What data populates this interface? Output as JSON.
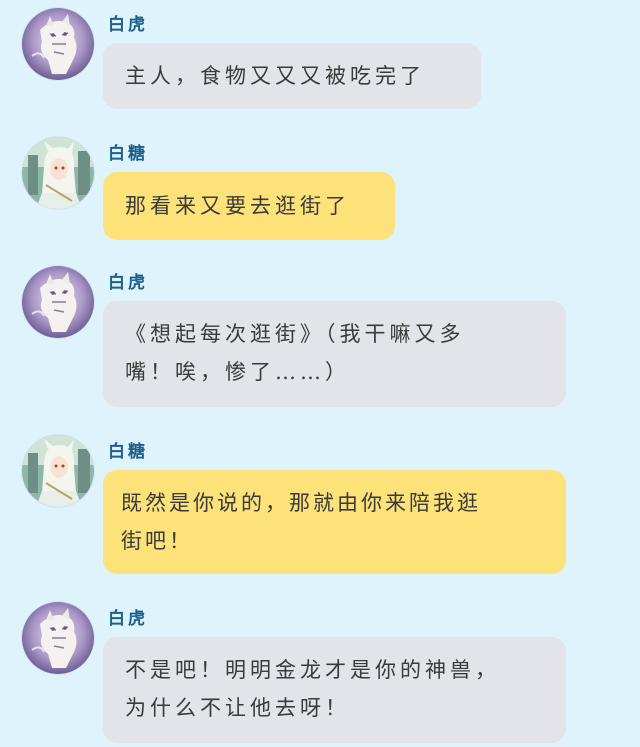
{
  "messages": [
    {
      "sender": "白虎",
      "avatar_icon": "white-tiger-avatar",
      "bubble_color": "#e2e4ea",
      "lines": [
        "主人，食物又又又被吃完了"
      ]
    },
    {
      "sender": "白糖",
      "avatar_icon": "white-haired-girl-avatar",
      "bubble_color": "#fde27a",
      "lines": [
        "那看来又要去逛街了"
      ]
    },
    {
      "sender": "白虎",
      "avatar_icon": "white-tiger-avatar",
      "bubble_color": "#e2e4ea",
      "lines": [
        "《想起每次逛街》（我干嘛又多",
        "嘴！唉，惨了……）"
      ]
    },
    {
      "sender": "白糖",
      "avatar_icon": "white-haired-girl-avatar",
      "bubble_color": "#fde27a",
      "lines": [
        "既然是你说的，那就由你来陪我逛",
        "街吧！"
      ]
    },
    {
      "sender": "白虎",
      "avatar_icon": "white-tiger-avatar",
      "bubble_color": "#e2e4ea",
      "lines": [
        "不是吧！明明金龙才是你的神兽，",
        "为什么不让他去呀！"
      ]
    }
  ],
  "colors": {
    "background": "#dff3fd",
    "sender_name": "#1d5f8c",
    "grey_bubble": "#e2e4ea",
    "yellow_bubble": "#fde27a"
  }
}
